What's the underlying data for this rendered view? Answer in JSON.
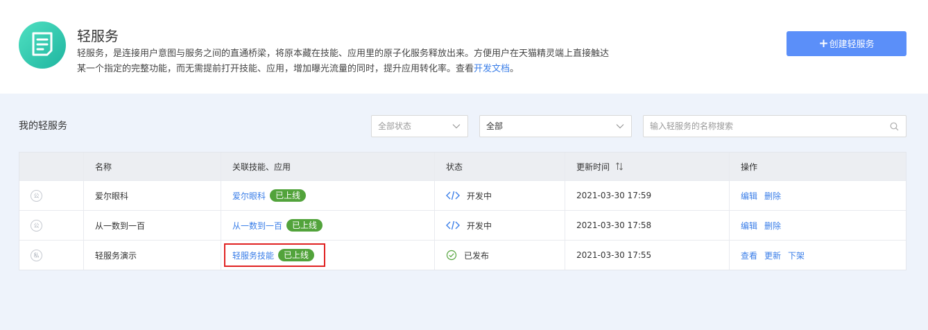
{
  "header": {
    "title": "轻服务",
    "desc_line1": "轻服务，是连接用户意图与服务之间的直通桥梁，将原本藏在技能、应用里的原子化服务释放出来。方便用户在天猫精灵端上直接触达",
    "desc_line2_prefix": "某一个指定的完整功能，而无需提前打开技能、应用，增加曝光流量的同时，提升应用转化率。查看",
    "desc_link": "开发文档",
    "desc_suffix": "。",
    "create_button": "创建轻服务",
    "create_button_plus": "+"
  },
  "section": {
    "title": "我的轻服务"
  },
  "filters": {
    "status_select": "全部状态",
    "type_select": "全部",
    "search_placeholder": "输入轻服务的名称搜索"
  },
  "table": {
    "columns": [
      "",
      "名称",
      "关联技能、应用",
      "状态",
      "更新时间",
      "操作"
    ],
    "rows": [
      {
        "type_icon": "公",
        "name": "爱尔眼科",
        "linked": "爱尔眼科",
        "badge": "已上线",
        "status_icon": "code-icon",
        "status": "开发中",
        "updated": "2021-03-30 17:59",
        "actions": [
          "编辑",
          "删除"
        ]
      },
      {
        "type_icon": "公",
        "name": "从一数到一百",
        "linked": "从一数到一百",
        "badge": "已上线",
        "status_icon": "code-icon",
        "status": "开发中",
        "updated": "2021-03-30 17:58",
        "actions": [
          "编辑",
          "删除"
        ]
      },
      {
        "type_icon": "私",
        "name": "轻服务演示",
        "linked": "轻服务技能",
        "badge": "已上线",
        "status_icon": "check-circle-icon",
        "status": "已发布",
        "updated": "2021-03-30 17:55",
        "actions": [
          "查看",
          "更新",
          "下架"
        ]
      }
    ]
  },
  "colors": {
    "primary": "#5b8ff9",
    "link": "#3a7ee8",
    "badge": "#52a33b",
    "highlight": "#e02020",
    "logo": "#2fc9ab"
  }
}
